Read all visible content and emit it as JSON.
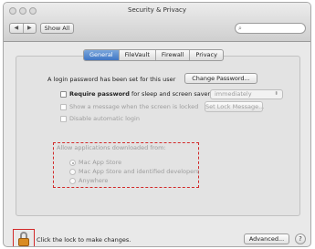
{
  "window": {
    "title": "Security & Privacy",
    "nav_back": "◀",
    "nav_forward": "▶",
    "show_all_label": "Show All",
    "search_placeholder": ""
  },
  "tabs": [
    {
      "label": "General",
      "active": true
    },
    {
      "label": "FileVault",
      "active": false
    },
    {
      "label": "Firewall",
      "active": false
    },
    {
      "label": "Privacy",
      "active": false
    }
  ],
  "general": {
    "login_password_text": "A login password has been set for this user",
    "change_password_label": "Change Password...",
    "require_password_label": "Require password",
    "require_password_suffix": "for sleep and screen saver",
    "require_password_value": "immediately",
    "show_message_label": "Show a message when the screen is locked",
    "set_lock_message_label": "Set Lock Message...",
    "disable_auto_login_label": "Disable automatic login"
  },
  "downloads": {
    "heading": "Allow applications downloaded from:",
    "options": [
      {
        "label": "Mac App Store",
        "selected": true
      },
      {
        "label": "Mac App Store and identified developers",
        "selected": false
      },
      {
        "label": "Anywhere",
        "selected": false
      }
    ]
  },
  "footer": {
    "lock_text": "Click the lock to make changes.",
    "advanced_label": "Advanced...",
    "help_label": "?"
  },
  "colors": {
    "highlight_red": "#d22a2a",
    "active_tab_blue": "#3f76c4",
    "lock_orange": "#d98c23"
  }
}
